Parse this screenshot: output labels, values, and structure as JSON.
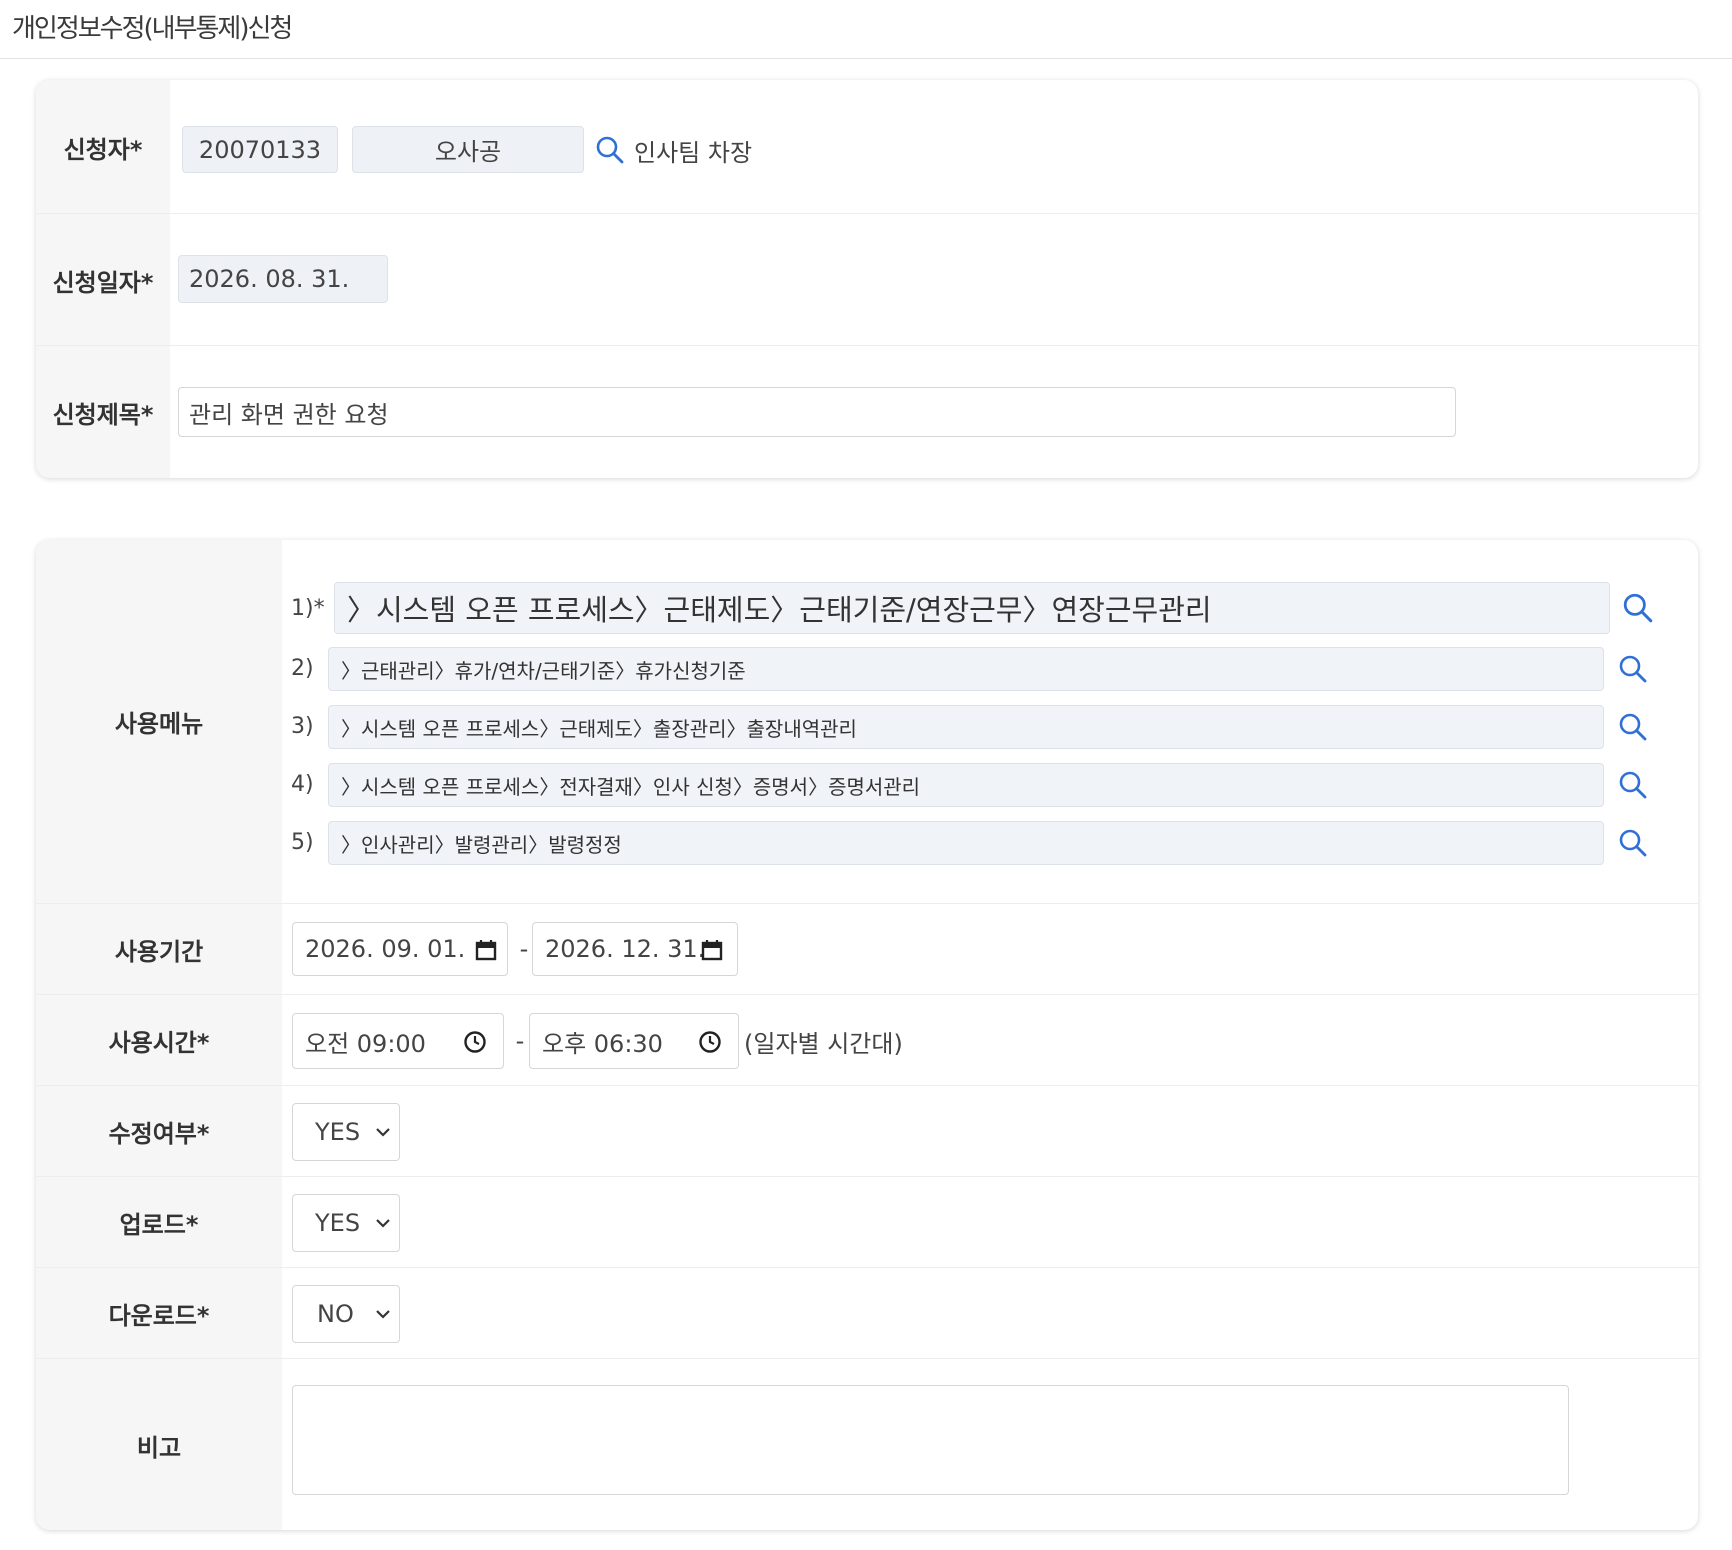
{
  "page": {
    "title": "개인정보수정(내부통제)신청"
  },
  "applicant_section": {
    "applicant_label": "신청자*",
    "employee_id": "20070133",
    "name": "오사공",
    "department_position": "인사팀 차장",
    "date_label": "신청일자*",
    "date": "2026. 08. 31.",
    "subject_label": "신청제목*",
    "subject": "관리 화면 권한 요청"
  },
  "usage_section": {
    "menu_label": "사용메뉴",
    "menus": [
      {
        "num": "1)*",
        "path": "〉시스템 오픈 프로세스〉근태제도〉근태기준/연장근무〉연장근무관리"
      },
      {
        "num": "2)",
        "path": "〉근태관리〉휴가/연차/근태기준〉휴가신청기준"
      },
      {
        "num": "3)",
        "path": "〉시스템 오픈 프로세스〉근태제도〉출장관리〉출장내역관리"
      },
      {
        "num": "4)",
        "path": "〉시스템 오픈 프로세스〉전자결재〉인사 신청〉증명서〉증명서관리"
      },
      {
        "num": "5)",
        "path": "〉인사관리〉발령관리〉발령정정"
      }
    ],
    "period_label": "사용기간",
    "period_start": "2026. 09. 01.",
    "period_end": "2026. 12. 31.",
    "time_label": "사용시간*",
    "time_start": "오전 09:00",
    "time_end": "오후 06:30",
    "time_note": "(일자별 시간대)",
    "modify_label": "수정여부*",
    "modify_value": "YES",
    "upload_label": "업로드*",
    "upload_value": "YES",
    "download_label": "다운로드*",
    "download_value": "NO",
    "remarks_label": "비고",
    "remarks_value": "",
    "range_sep": "-"
  },
  "colors": {
    "accent": "#2f6fd6",
    "label_bg": "#f6f6f6",
    "field_bg": "#eef1f6"
  }
}
